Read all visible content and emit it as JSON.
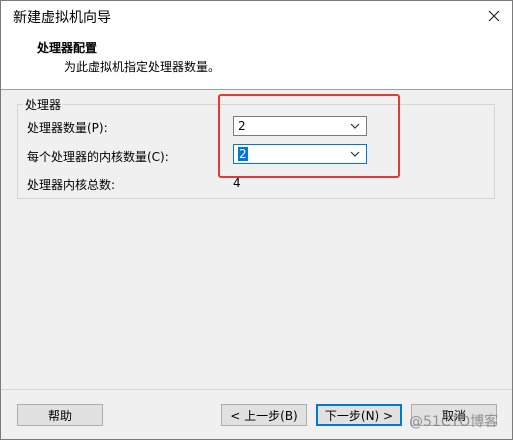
{
  "window": {
    "title": "新建虚拟机向导"
  },
  "header": {
    "title": "处理器配置",
    "subtitle": "为此虚拟机指定处理器数量。"
  },
  "group": {
    "legend": "处理器",
    "processors_label": "处理器数量(P):",
    "processors_value": "2",
    "cores_label": "每个处理器的内核数量(C):",
    "cores_value": "2",
    "total_label": "处理器内核总数:",
    "total_value": "4"
  },
  "buttons": {
    "help": "帮助",
    "back": "< 上一步(B)",
    "next": "下一步(N) >",
    "cancel": "取消"
  },
  "watermark": "@51CTO博客",
  "colors": {
    "highlight": "#e53935",
    "selection": "#0078d7"
  }
}
